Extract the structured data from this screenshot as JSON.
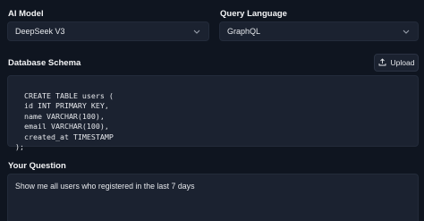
{
  "ai_model": {
    "label": "AI Model",
    "selected": "DeepSeek V3"
  },
  "query_language": {
    "label": "Query Language",
    "selected": "GraphQL"
  },
  "schema": {
    "label": "Database Schema",
    "upload_label": "Upload",
    "value": "CREATE TABLE users (\n  id INT PRIMARY KEY,\n  name VARCHAR(100),\n  email VARCHAR(100),\n  created_at TIMESTAMP\n);"
  },
  "question": {
    "label": "Your Question",
    "value": "Show me all users who registered in the last 7 days"
  }
}
